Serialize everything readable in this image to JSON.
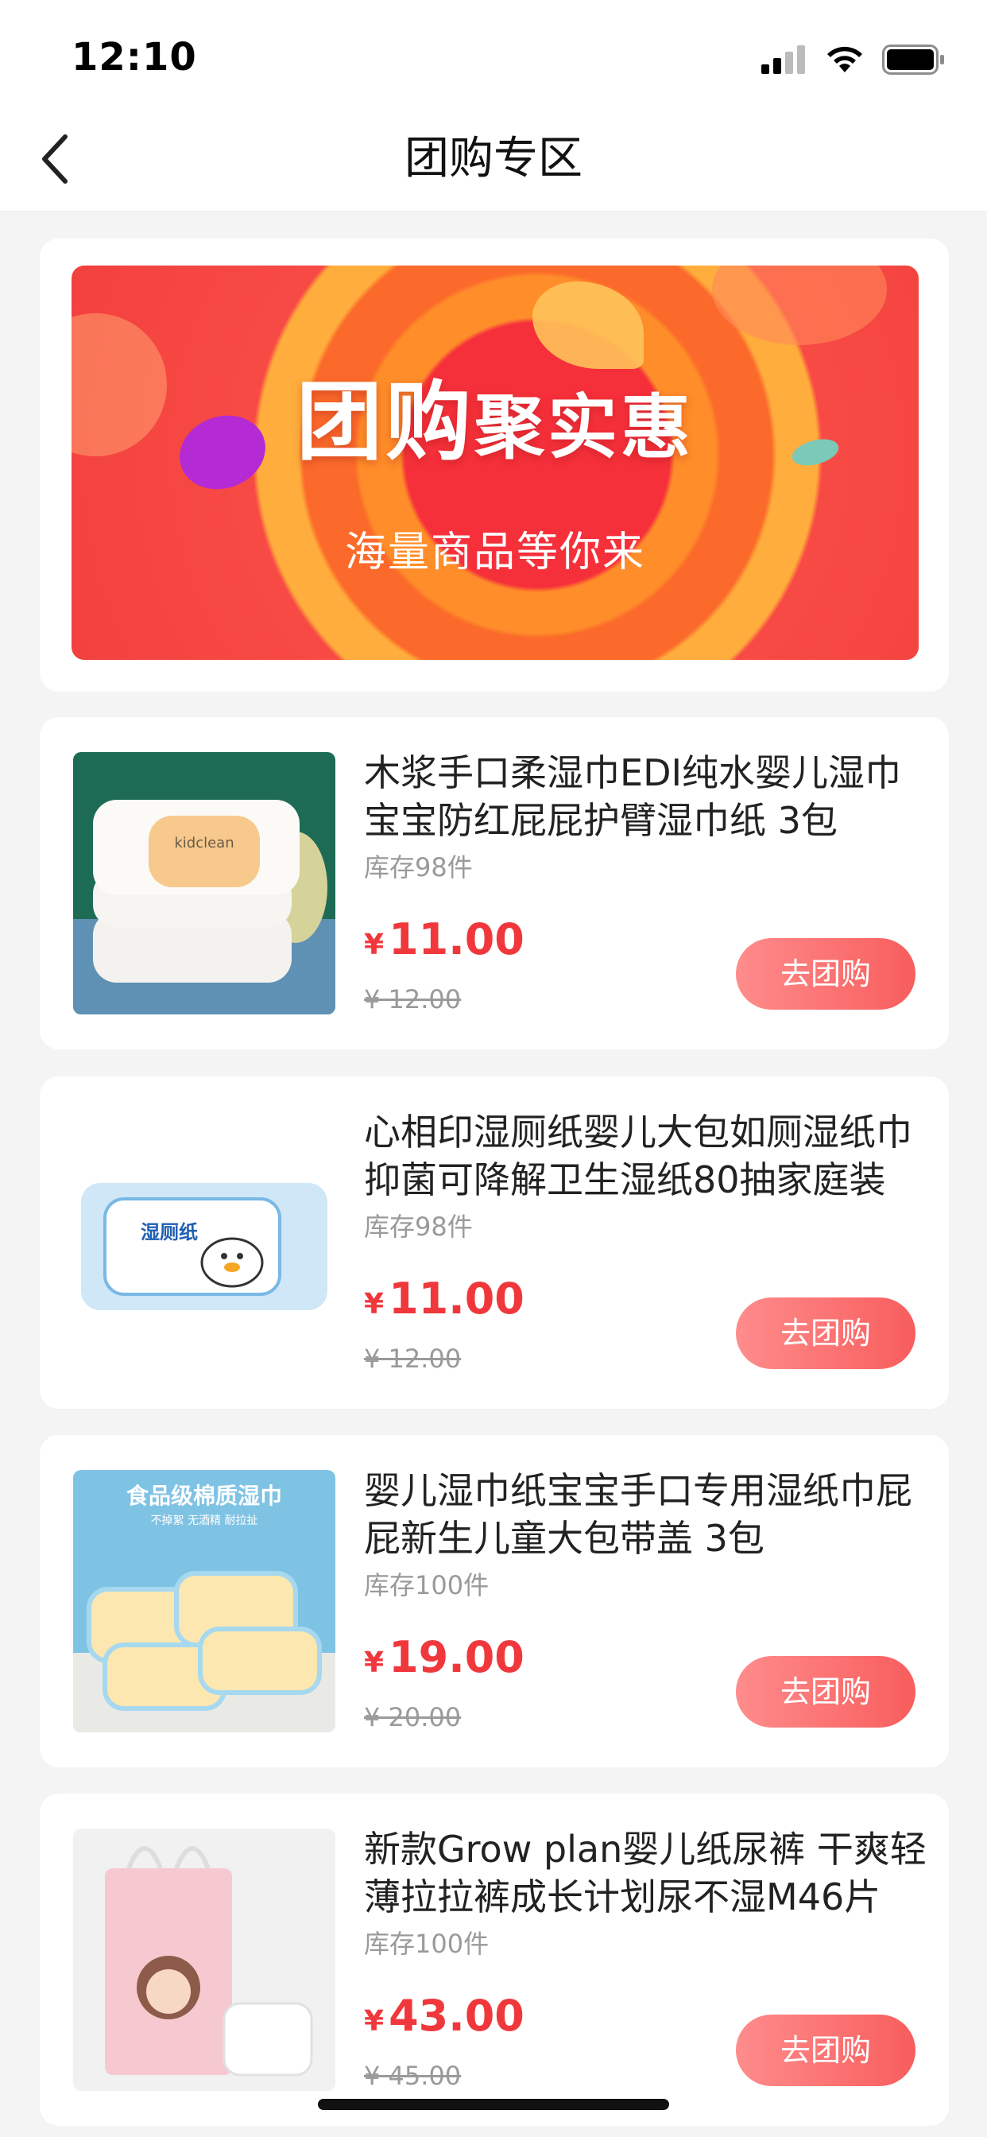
{
  "status_bar": {
    "time": "12:10"
  },
  "nav": {
    "title": "团购专区"
  },
  "banner": {
    "title_part1": "团购",
    "title_part2": "聚实惠",
    "subtitle": "海量商品等你来"
  },
  "products": [
    {
      "title": "木浆手口柔湿巾EDI纯水婴儿湿巾宝宝防红屁屁护臂湿巾纸 3包",
      "stock": "库存98件",
      "currency": "¥",
      "price": "11.00",
      "original_price": "¥ 12.00",
      "button": "去团购",
      "image_brand_text": "kidclean"
    },
    {
      "title": "心相印湿厕纸婴儿大包如厕湿纸巾抑菌可降解卫生湿纸80抽家庭装",
      "stock": "库存98件",
      "currency": "¥",
      "price": "11.00",
      "original_price": "¥ 12.00",
      "button": "去团购",
      "image_brand_text": "湿厕纸"
    },
    {
      "title": "婴儿湿巾纸宝宝手口专用湿纸巾屁屁新生儿童大包带盖 3包",
      "stock": "库存100件",
      "currency": "¥",
      "price": "19.00",
      "original_price": "¥ 20.00",
      "button": "去团购",
      "image_brand_text": "食品级棉质湿巾",
      "image_sub_text": "不掉絮 无酒精 耐拉扯"
    },
    {
      "title": "新款Grow plan婴儿纸尿裤 干爽轻薄拉拉裤成长计划尿不湿M46片",
      "stock": "库存100件",
      "currency": "¥",
      "price": "43.00",
      "original_price": "¥ 45.00",
      "button": "去团购"
    }
  ]
}
